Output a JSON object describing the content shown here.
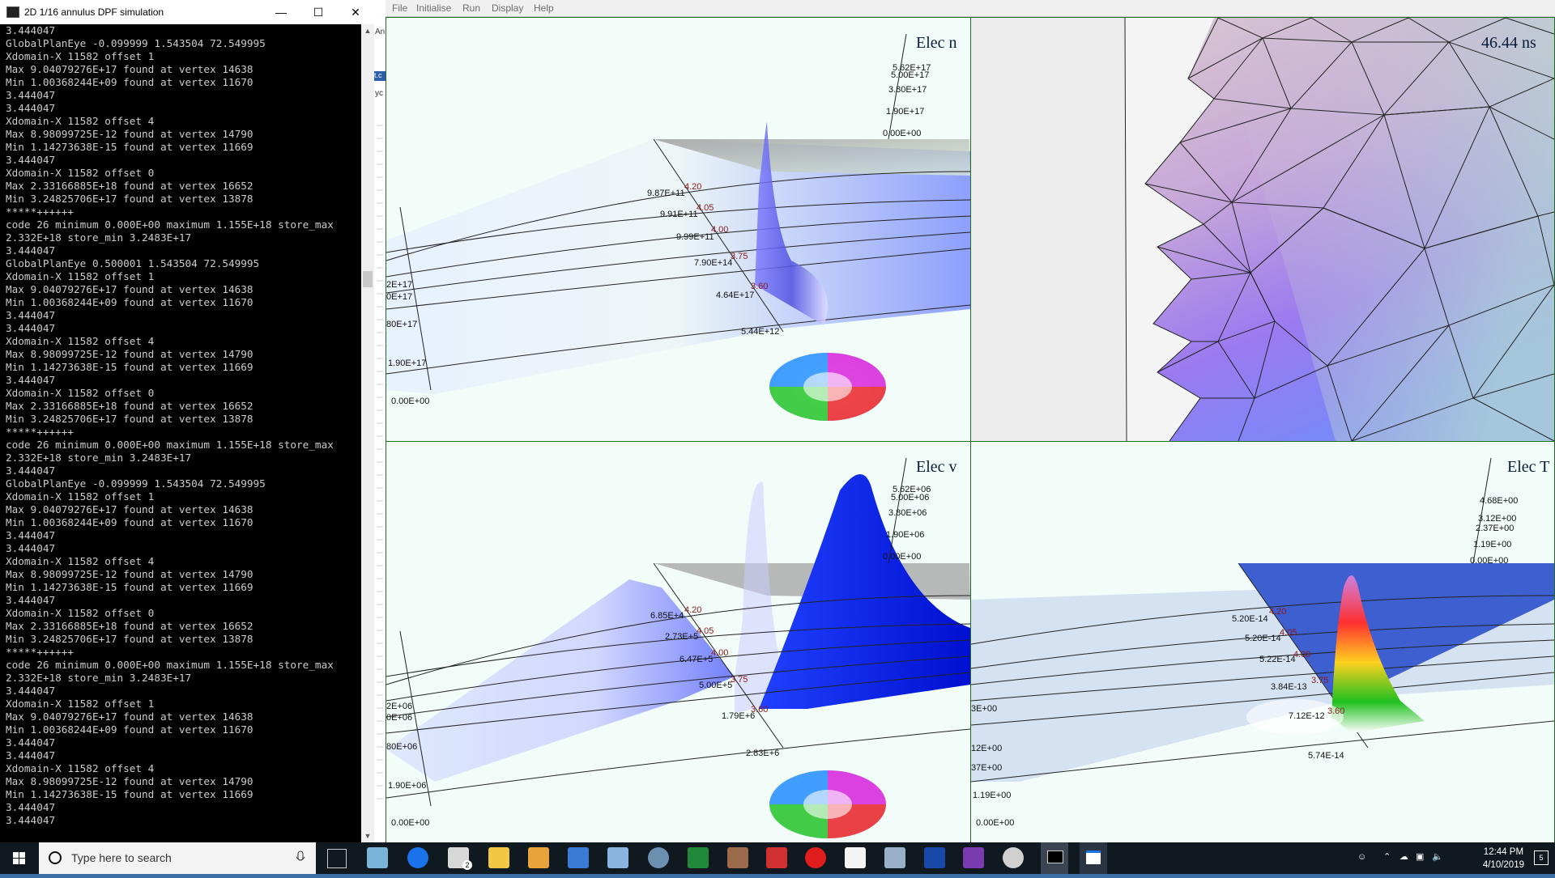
{
  "console": {
    "title": "2D 1/16 annulus DPF simulation",
    "lines": [
      "3.444047",
      "GlobalPlanEye -0.099999 1.543504 72.549995",
      "Xdomain-X 11582 offset 1",
      "Max 9.04079276E+17 found at vertex 14638",
      "Min 1.00368244E+09 found at vertex 11670",
      "3.444047",
      "3.444047",
      "Xdomain-X 11582 offset 4",
      "Max 8.98099725E-12 found at vertex 14790",
      "Min 1.14273638E-15 found at vertex 11669",
      "3.444047",
      "Xdomain-X 11582 offset 0",
      "Max 2.33166885E+18 found at vertex 16652",
      "Min 3.24825706E+17 found at vertex 13878",
      "*****++++++",
      "code 26 minimum 0.000E+00 maximum 1.155E+18 store_max",
      "2.332E+18 store_min 3.2483E+17",
      "3.444047",
      "GlobalPlanEye 0.500001 1.543504 72.549995",
      "Xdomain-X 11582 offset 1",
      "Max 9.04079276E+17 found at vertex 14638",
      "Min 1.00368244E+09 found at vertex 11670",
      "3.444047",
      "3.444047",
      "Xdomain-X 11582 offset 4",
      "Max 8.98099725E-12 found at vertex 14790",
      "Min 1.14273638E-15 found at vertex 11669",
      "3.444047",
      "Xdomain-X 11582 offset 0",
      "Max 2.33166885E+18 found at vertex 16652",
      "Min 3.24825706E+17 found at vertex 13878",
      "*****++++++",
      "code 26 minimum 0.000E+00 maximum 1.155E+18 store_max",
      "2.332E+18 store_min 3.2483E+17",
      "3.444047",
      "GlobalPlanEye -0.099999 1.543504 72.549995",
      "Xdomain-X 11582 offset 1",
      "Max 9.04079276E+17 found at vertex 14638",
      "Min 1.00368244E+09 found at vertex 11670",
      "3.444047",
      "3.444047",
      "Xdomain-X 11582 offset 4",
      "Max 8.98099725E-12 found at vertex 14790",
      "Min 1.14273638E-15 found at vertex 11669",
      "3.444047",
      "Xdomain-X 11582 offset 0",
      "Max 2.33166885E+18 found at vertex 16652",
      "Min 3.24825706E+17 found at vertex 13878",
      "*****++++++",
      "code 26 minimum 0.000E+00 maximum 1.155E+18 store_max",
      "2.332E+18 store_min 3.2483E+17",
      "3.444047",
      "Xdomain-X 11582 offset 1",
      "Max 9.04079276E+17 found at vertex 14638",
      "Min 1.00368244E+09 found at vertex 11670",
      "3.444047",
      "3.444047",
      "Xdomain-X 11582 offset 4",
      "Max 8.98099725E-12 found at vertex 14790",
      "Min 1.14273638E-15 found at vertex 11669",
      "3.444047",
      "3.444047"
    ]
  },
  "sliver": {
    "texts": [
      "An",
      "t.c",
      "yc"
    ]
  },
  "menu": {
    "file": "File",
    "initialise": "Initialise",
    "run": "Run",
    "display": "Display",
    "help": "Help"
  },
  "panels": {
    "elec_n": {
      "title": "Elec n",
      "scale": [
        "5.62E+17",
        "5.00E+17",
        "3.80E+17",
        "1.90E+17",
        "0.00E+00"
      ],
      "left_axis": [
        "2E+17",
        "0E+17",
        "80E+17",
        "1.90E+17",
        "0.00E+00"
      ],
      "grid_labels": [
        "9.87E+11",
        "9.91E+11",
        "9.99E+11",
        "7.90E+14",
        "4.64E+17",
        "5.44E+12"
      ],
      "radii": [
        "4.20",
        "4.05",
        "4.00",
        "3.75",
        "3.60"
      ]
    },
    "mesh": {
      "time": "46.44 ns"
    },
    "elec_v": {
      "title": "Elec v",
      "scale": [
        "5.62E+06",
        "5.00E+06",
        "3.80E+06",
        "1.90E+06",
        "0.00E+00"
      ],
      "left_axis": [
        "2E+06",
        "0E+06",
        "80E+06",
        "1.90E+06",
        "0.00E+00"
      ],
      "grid_labels": [
        "6.85E+4",
        "2.73E+5",
        "6.47E+5",
        "5.00E+5",
        "1.79E+6",
        "2.83E+6"
      ],
      "radii": [
        "4.20",
        "4.05",
        "4.00",
        "3.75",
        "3.60"
      ]
    },
    "elec_t": {
      "title": "Elec T",
      "scale": [
        "4.68E+00",
        "3.12E+00",
        "2.37E+00",
        "1.19E+00",
        "0.00E+00"
      ],
      "left_axis": [
        "3E+00",
        "12E+00",
        "37E+00",
        "1.19E+00",
        "0.00E+00"
      ],
      "grid_labels": [
        "5.20E-14",
        "5.20E-14",
        "5.22E-14",
        "3.84E-13",
        "7.12E-12",
        "5.74E-14"
      ],
      "radii": [
        "4.20",
        "4.05",
        "4.00",
        "3.75",
        "3.60"
      ]
    }
  },
  "taskbar": {
    "search_placeholder": "Type here to search",
    "time": "12:44 PM",
    "date": "4/10/2019",
    "notification_count": "5",
    "mail_badge": "2"
  }
}
